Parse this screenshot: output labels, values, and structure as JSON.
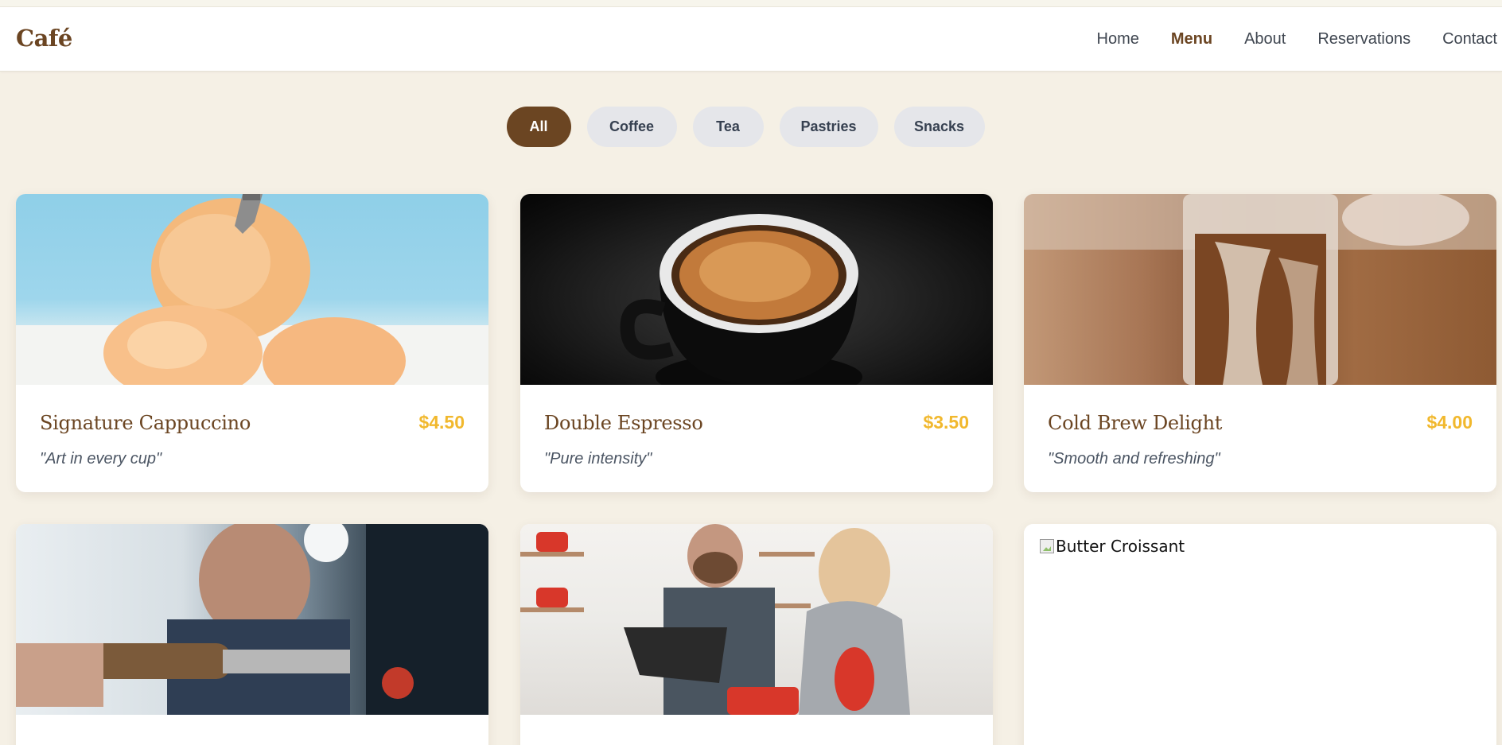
{
  "brand": "Café",
  "nav": [
    {
      "label": "Home",
      "active": false
    },
    {
      "label": "Menu",
      "active": true
    },
    {
      "label": "About",
      "active": false
    },
    {
      "label": "Reservations",
      "active": false
    },
    {
      "label": "Contact",
      "active": false
    }
  ],
  "filters": [
    {
      "label": "All",
      "active": true
    },
    {
      "label": "Coffee",
      "active": false
    },
    {
      "label": "Tea",
      "active": false
    },
    {
      "label": "Pastries",
      "active": false
    },
    {
      "label": "Snacks",
      "active": false
    }
  ],
  "menu_items": [
    {
      "name": "Signature Cappuccino",
      "price": "$4.50",
      "tagline": "\"Art in every cup\"",
      "image": "ice-cream-scoops-photo"
    },
    {
      "name": "Double Espresso",
      "price": "$3.50",
      "tagline": "\"Pure intensity\"",
      "image": "espresso-cup-photo"
    },
    {
      "name": "Cold Brew Delight",
      "price": "$4.00",
      "tagline": "\"Smooth and refreshing\"",
      "image": "iced-coffee-glass-photo"
    },
    {
      "image": "barista-tamping-photo"
    },
    {
      "image": "couple-cooking-photo"
    },
    {
      "image_alt": "Butter Croissant",
      "image": "broken-image-icon"
    }
  ],
  "colors": {
    "brand": "#6b4522",
    "price": "#f1b82d",
    "background": "#f5f0e5",
    "pill_inactive": "#e5e6ea"
  }
}
